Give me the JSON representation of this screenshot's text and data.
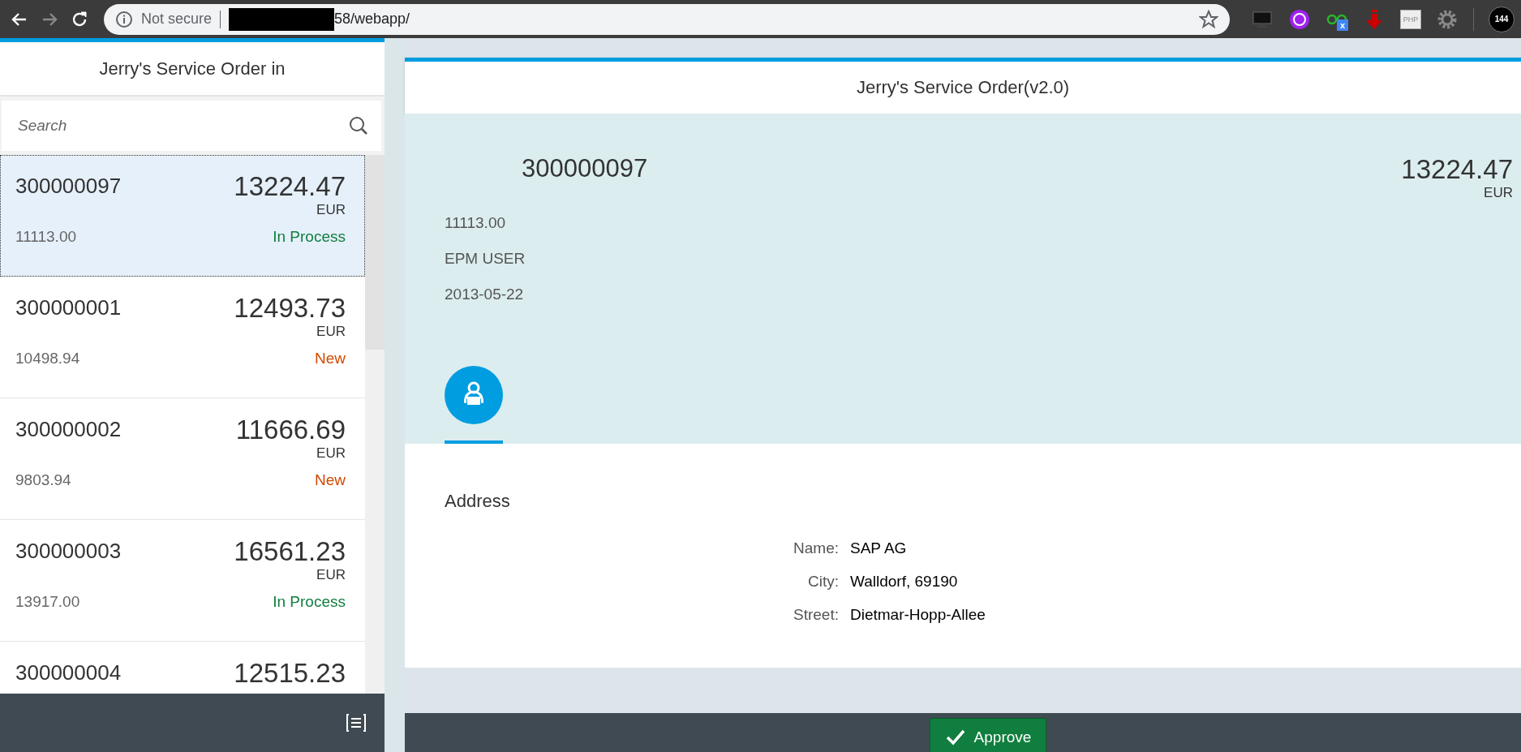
{
  "browser": {
    "nav": [
      {
        "kind": "back",
        "disabled": false
      },
      {
        "kind": "forward",
        "disabled": true
      },
      {
        "kind": "reload",
        "disabled": false
      }
    ],
    "security": "Not secure",
    "url": "58/webapp/",
    "extensions": [
      {
        "kind": "monitor"
      },
      {
        "kind": "purple"
      },
      {
        "kind": "glasses",
        "badge": "x"
      },
      {
        "kind": "download"
      },
      {
        "kind": "php",
        "label": "PHP"
      },
      {
        "kind": "gear"
      }
    ],
    "profile_badge": "144"
  },
  "master": {
    "title": "Jerry's Service Order in",
    "search": {
      "placeholder": "Search"
    },
    "items": [
      {
        "id": "300000097",
        "amount": "13224.47",
        "currency": "EUR",
        "net": "11113.00",
        "status": "In Process",
        "color": "#107e3e",
        "selected": true
      },
      {
        "id": "300000001",
        "amount": "12493.73",
        "currency": "EUR",
        "net": "10498.94",
        "status": "New",
        "color": "#d14900",
        "selected": false
      },
      {
        "id": "300000002",
        "amount": "11666.69",
        "currency": "EUR",
        "net": "9803.94",
        "status": "New",
        "color": "#d14900",
        "selected": false
      },
      {
        "id": "300000003",
        "amount": "16561.23",
        "currency": "EUR",
        "net": "13917.00",
        "status": "In Process",
        "color": "#107e3e",
        "selected": false
      },
      {
        "id": "300000004",
        "amount": "12515.23",
        "selected": false
      }
    ]
  },
  "detail": {
    "title": "Jerry's Service Order(v2.0)",
    "header": {
      "id": "300000097",
      "amount": "13224.47",
      "currency": "EUR",
      "attributes": [
        "11113.00",
        "EPM USER",
        "2013-05-22"
      ]
    },
    "tabs": [
      {
        "kind": "person",
        "selected": true
      }
    ],
    "section": {
      "title": "Address",
      "fields": [
        {
          "label": "Name:",
          "value": "SAP AG"
        },
        {
          "label": "City:",
          "value": "Walldorf, 69190"
        },
        {
          "label": "Street:",
          "value": "Dietmar-Hopp-Allee"
        }
      ]
    },
    "footer": {
      "buttons": [
        {
          "kind": "accept",
          "label": "Approve"
        }
      ]
    }
  }
}
